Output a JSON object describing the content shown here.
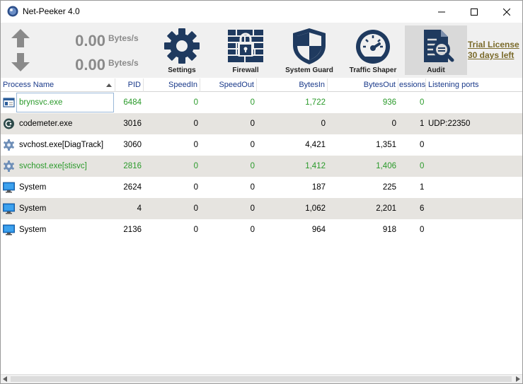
{
  "window": {
    "title": "Net-Peeker 4.0"
  },
  "speed": {
    "upload_value": "0.00",
    "upload_unit": "Bytes/s",
    "download_value": "0.00",
    "download_unit": "Bytes/s"
  },
  "toolbar": {
    "settings": "Settings",
    "firewall": "Firewall",
    "system_guard": "System Guard",
    "traffic_shaper": "Traffic Shaper",
    "audit": "Audit"
  },
  "license": {
    "line1": "Trial License",
    "line2": "30 days left"
  },
  "table": {
    "columns": [
      "Process Name",
      "PID",
      "SpeedIn",
      "SpeedOut",
      "BytesIn",
      "BytesOut",
      "essions",
      "Listening ports"
    ],
    "rows": [
      {
        "icon": "window-app-icon",
        "name": "brynsvc.exe",
        "pid": "6484",
        "speed_in": "0",
        "speed_out": "0",
        "bytes_in": "1,722",
        "bytes_out": "936",
        "sessions": "0",
        "ports": "",
        "color": "#2a9a2a"
      },
      {
        "icon": "codemeter-icon",
        "name": "codemeter.exe",
        "pid": "3016",
        "speed_in": "0",
        "speed_out": "0",
        "bytes_in": "0",
        "bytes_out": "0",
        "sessions": "1",
        "ports": "UDP:22350",
        "color": "#000000"
      },
      {
        "icon": "service-gear-icon",
        "name": "svchost.exe[DiagTrack]",
        "pid": "3060",
        "speed_in": "0",
        "speed_out": "0",
        "bytes_in": "4,421",
        "bytes_out": "1,351",
        "sessions": "0",
        "ports": "",
        "color": "#000000"
      },
      {
        "icon": "service-gear-icon",
        "name": "svchost.exe[stisvc]",
        "pid": "2816",
        "speed_in": "0",
        "speed_out": "0",
        "bytes_in": "1,412",
        "bytes_out": "1,406",
        "sessions": "0",
        "ports": "",
        "color": "#2a9a2a"
      },
      {
        "icon": "monitor-icon",
        "name": "System",
        "pid": "2624",
        "speed_in": "0",
        "speed_out": "0",
        "bytes_in": "187",
        "bytes_out": "225",
        "sessions": "1",
        "ports": "",
        "color": "#000000"
      },
      {
        "icon": "monitor-icon",
        "name": "System",
        "pid": "4",
        "speed_in": "0",
        "speed_out": "0",
        "bytes_in": "1,062",
        "bytes_out": "2,201",
        "sessions": "6",
        "ports": "",
        "color": "#000000"
      },
      {
        "icon": "monitor-icon",
        "name": "System",
        "pid": "2136",
        "speed_in": "0",
        "speed_out": "0",
        "bytes_in": "964",
        "bytes_out": "918",
        "sessions": "0",
        "ports": "",
        "color": "#000000"
      }
    ]
  },
  "colors": {
    "accent_green": "#2a9a2a",
    "icon_navy": "#1f3a5f",
    "license_gold": "#7a6a2a"
  }
}
